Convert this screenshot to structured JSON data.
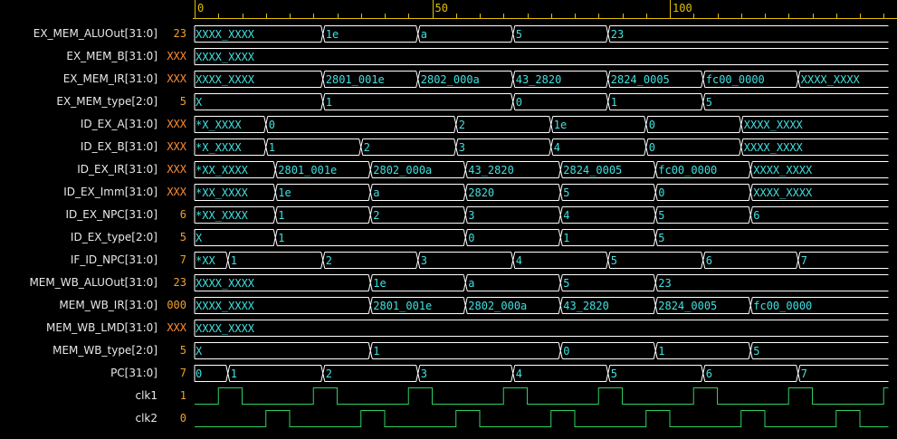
{
  "colors": {
    "background": "#000000",
    "ruler": "#e0c000",
    "bus_line": "#ffffff",
    "bus_text": "#40e0e0",
    "clock": "#30d060",
    "value_default": "#f0a030",
    "value_x": "#ff8c30",
    "name_text": "#e8e8e8"
  },
  "ruler": {
    "ticks": [
      {
        "t": 0,
        "label": "0"
      },
      {
        "t": 50,
        "label": "50"
      },
      {
        "t": 100,
        "label": "100"
      }
    ],
    "time_range": [
      0,
      146
    ]
  },
  "signals": [
    {
      "name": "EX_MEM_ALUOut[31:0]",
      "value": "23",
      "type": "bus",
      "segments": [
        {
          "t": 0,
          "label": "XXXX_XXXX"
        },
        {
          "t": 27,
          "label": "1e"
        },
        {
          "t": 47,
          "label": "a"
        },
        {
          "t": 67,
          "label": "5"
        },
        {
          "t": 87,
          "label": "23"
        }
      ]
    },
    {
      "name": "EX_MEM_B[31:0]",
      "value": "XXX",
      "type": "bus",
      "segments": [
        {
          "t": 0,
          "label": "XXXX_XXXX"
        }
      ]
    },
    {
      "name": "EX_MEM_IR[31:0]",
      "value": "XXX",
      "type": "bus",
      "segments": [
        {
          "t": 0,
          "label": "XXXX_XXXX"
        },
        {
          "t": 27,
          "label": "2801_001e"
        },
        {
          "t": 47,
          "label": "2802_000a"
        },
        {
          "t": 67,
          "label": "43_2820"
        },
        {
          "t": 87,
          "label": "2824_0005"
        },
        {
          "t": 107,
          "label": "fc00_0000"
        },
        {
          "t": 127,
          "label": "XXXX_XXXX"
        }
      ]
    },
    {
      "name": "EX_MEM_type[2:0]",
      "value": "5",
      "type": "bus",
      "segments": [
        {
          "t": 0,
          "label": "X"
        },
        {
          "t": 27,
          "label": "1"
        },
        {
          "t": 67,
          "label": "0"
        },
        {
          "t": 87,
          "label": "1"
        },
        {
          "t": 107,
          "label": "5"
        }
      ]
    },
    {
      "name": "ID_EX_A[31:0]",
      "value": "XXX",
      "type": "bus",
      "segments": [
        {
          "t": 0,
          "label": "*X_XXXX"
        },
        {
          "t": 15,
          "label": "0"
        },
        {
          "t": 55,
          "label": "2"
        },
        {
          "t": 75,
          "label": "1e"
        },
        {
          "t": 95,
          "label": "0"
        },
        {
          "t": 115,
          "label": "XXXX_XXXX"
        }
      ]
    },
    {
      "name": "ID_EX_B[31:0]",
      "value": "XXX",
      "type": "bus",
      "segments": [
        {
          "t": 0,
          "label": "*X_XXXX"
        },
        {
          "t": 15,
          "label": "1"
        },
        {
          "t": 35,
          "label": "2"
        },
        {
          "t": 55,
          "label": "3"
        },
        {
          "t": 75,
          "label": "4"
        },
        {
          "t": 95,
          "label": "0"
        },
        {
          "t": 115,
          "label": "XXXX_XXXX"
        }
      ]
    },
    {
      "name": "ID_EX_IR[31:0]",
      "value": "XXX",
      "type": "bus",
      "segments": [
        {
          "t": 0,
          "label": "*XX_XXXX"
        },
        {
          "t": 17,
          "label": "2801_001e"
        },
        {
          "t": 37,
          "label": "2802_000a"
        },
        {
          "t": 57,
          "label": "43_2820"
        },
        {
          "t": 77,
          "label": "2824_0005"
        },
        {
          "t": 97,
          "label": "fc00_0000"
        },
        {
          "t": 117,
          "label": "XXXX_XXXX"
        }
      ]
    },
    {
      "name": "ID_EX_Imm[31:0]",
      "value": "XXX",
      "type": "bus",
      "segments": [
        {
          "t": 0,
          "label": "*XX_XXXX"
        },
        {
          "t": 17,
          "label": "1e"
        },
        {
          "t": 37,
          "label": "a"
        },
        {
          "t": 57,
          "label": "2820"
        },
        {
          "t": 77,
          "label": "5"
        },
        {
          "t": 97,
          "label": "0"
        },
        {
          "t": 117,
          "label": "XXXX_XXXX"
        }
      ]
    },
    {
      "name": "ID_EX_NPC[31:0]",
      "value": "6",
      "type": "bus",
      "segments": [
        {
          "t": 0,
          "label": "*XX_XXXX"
        },
        {
          "t": 17,
          "label": "1"
        },
        {
          "t": 37,
          "label": "2"
        },
        {
          "t": 57,
          "label": "3"
        },
        {
          "t": 77,
          "label": "4"
        },
        {
          "t": 97,
          "label": "5"
        },
        {
          "t": 117,
          "label": "6"
        }
      ]
    },
    {
      "name": "ID_EX_type[2:0]",
      "value": "5",
      "type": "bus",
      "segments": [
        {
          "t": 0,
          "label": "X"
        },
        {
          "t": 17,
          "label": "1"
        },
        {
          "t": 57,
          "label": "0"
        },
        {
          "t": 77,
          "label": "1"
        },
        {
          "t": 97,
          "label": "5"
        }
      ]
    },
    {
      "name": "IF_ID_NPC[31:0]",
      "value": "7",
      "type": "bus",
      "segments": [
        {
          "t": 0,
          "label": "*XX"
        },
        {
          "t": 7,
          "label": "1"
        },
        {
          "t": 27,
          "label": "2"
        },
        {
          "t": 47,
          "label": "3"
        },
        {
          "t": 67,
          "label": "4"
        },
        {
          "t": 87,
          "label": "5"
        },
        {
          "t": 107,
          "label": "6"
        },
        {
          "t": 127,
          "label": "7"
        }
      ]
    },
    {
      "name": "MEM_WB_ALUOut[31:0]",
      "value": "23",
      "type": "bus",
      "segments": [
        {
          "t": 0,
          "label": "XXXX_XXXX"
        },
        {
          "t": 37,
          "label": "1e"
        },
        {
          "t": 57,
          "label": "a"
        },
        {
          "t": 77,
          "label": "5"
        },
        {
          "t": 97,
          "label": "23"
        }
      ]
    },
    {
      "name": "MEM_WB_IR[31:0]",
      "value": "000",
      "type": "bus",
      "segments": [
        {
          "t": 0,
          "label": "XXXX_XXXX"
        },
        {
          "t": 37,
          "label": "2801_001e"
        },
        {
          "t": 57,
          "label": "2802_000a"
        },
        {
          "t": 77,
          "label": "43_2820"
        },
        {
          "t": 97,
          "label": "2824_0005"
        },
        {
          "t": 117,
          "label": "fc00_0000"
        }
      ]
    },
    {
      "name": "MEM_WB_LMD[31:0]",
      "value": "XXX",
      "type": "bus",
      "segments": [
        {
          "t": 0,
          "label": "XXXX_XXXX"
        }
      ]
    },
    {
      "name": "MEM_WB_type[2:0]",
      "value": "5",
      "type": "bus",
      "segments": [
        {
          "t": 0,
          "label": "X"
        },
        {
          "t": 37,
          "label": "1"
        },
        {
          "t": 77,
          "label": "0"
        },
        {
          "t": 97,
          "label": "1"
        },
        {
          "t": 117,
          "label": "5"
        }
      ]
    },
    {
      "name": "PC[31:0]",
      "value": "7",
      "type": "bus",
      "segments": [
        {
          "t": 0,
          "label": "0"
        },
        {
          "t": 7,
          "label": "1"
        },
        {
          "t": 27,
          "label": "2"
        },
        {
          "t": 47,
          "label": "3"
        },
        {
          "t": 67,
          "label": "4"
        },
        {
          "t": 87,
          "label": "5"
        },
        {
          "t": 107,
          "label": "6"
        },
        {
          "t": 127,
          "label": "7"
        }
      ]
    },
    {
      "name": "clk1",
      "value": "1",
      "type": "clock",
      "initial": 0,
      "edges": [
        5,
        10,
        25,
        30,
        45,
        50,
        65,
        70,
        85,
        90,
        105,
        110,
        125,
        130,
        145
      ]
    },
    {
      "name": "clk2",
      "value": "0",
      "type": "clock",
      "initial": 0,
      "edges": [
        15,
        20,
        35,
        40,
        55,
        60,
        75,
        80,
        95,
        100,
        115,
        120,
        135,
        140
      ]
    }
  ]
}
